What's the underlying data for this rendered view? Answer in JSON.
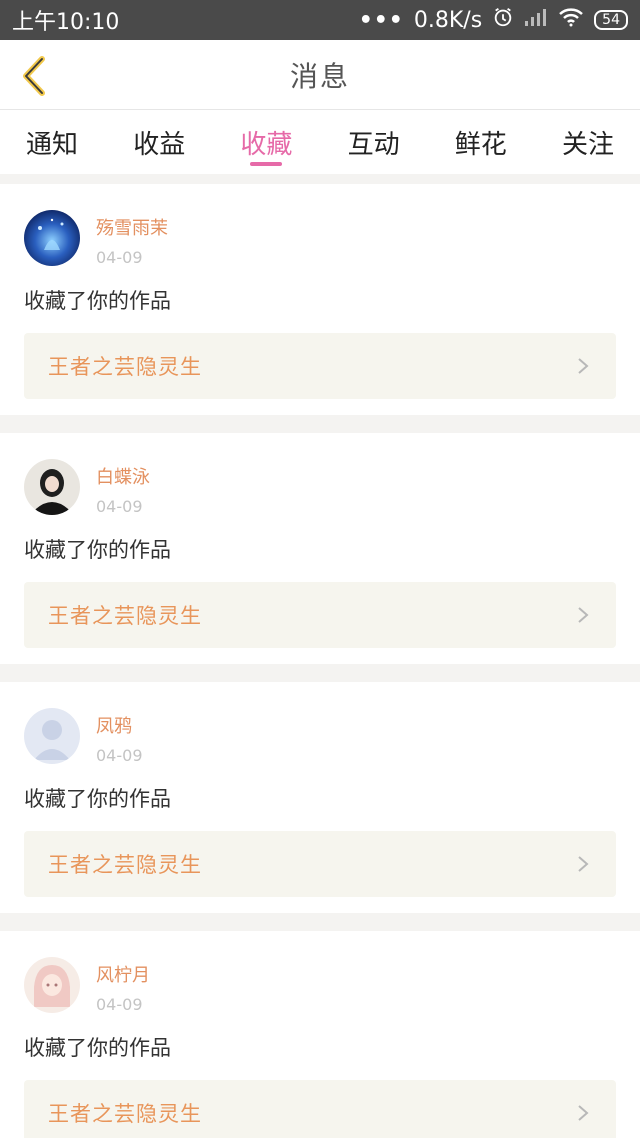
{
  "status": {
    "time": "上午10:10",
    "dots": "•••",
    "speed": "0.8K/s",
    "battery": "54"
  },
  "header": {
    "title": "消息"
  },
  "tabs": [
    {
      "label": "通知"
    },
    {
      "label": "收益"
    },
    {
      "label": "收藏"
    },
    {
      "label": "互动"
    },
    {
      "label": "鲜花"
    },
    {
      "label": "关注"
    }
  ],
  "active_tab": "收藏",
  "items": [
    {
      "name": "殇雪雨茉",
      "date": "04-09",
      "action": "收藏了你的作品",
      "work": "王者之芸隐灵生"
    },
    {
      "name": "白蝶泳",
      "date": "04-09",
      "action": "收藏了你的作品",
      "work": "王者之芸隐灵生"
    },
    {
      "name": "凤鸦",
      "date": "04-09",
      "action": "收藏了你的作品",
      "work": "王者之芸隐灵生"
    },
    {
      "name": "风柠月",
      "date": "04-09",
      "action": "收藏了你的作品",
      "work": "王者之芸隐灵生"
    }
  ],
  "colors": {
    "accent": "#e66aa8",
    "name": "#e39060",
    "work": "#e8955a",
    "card_bg": "#f6f5ee"
  }
}
